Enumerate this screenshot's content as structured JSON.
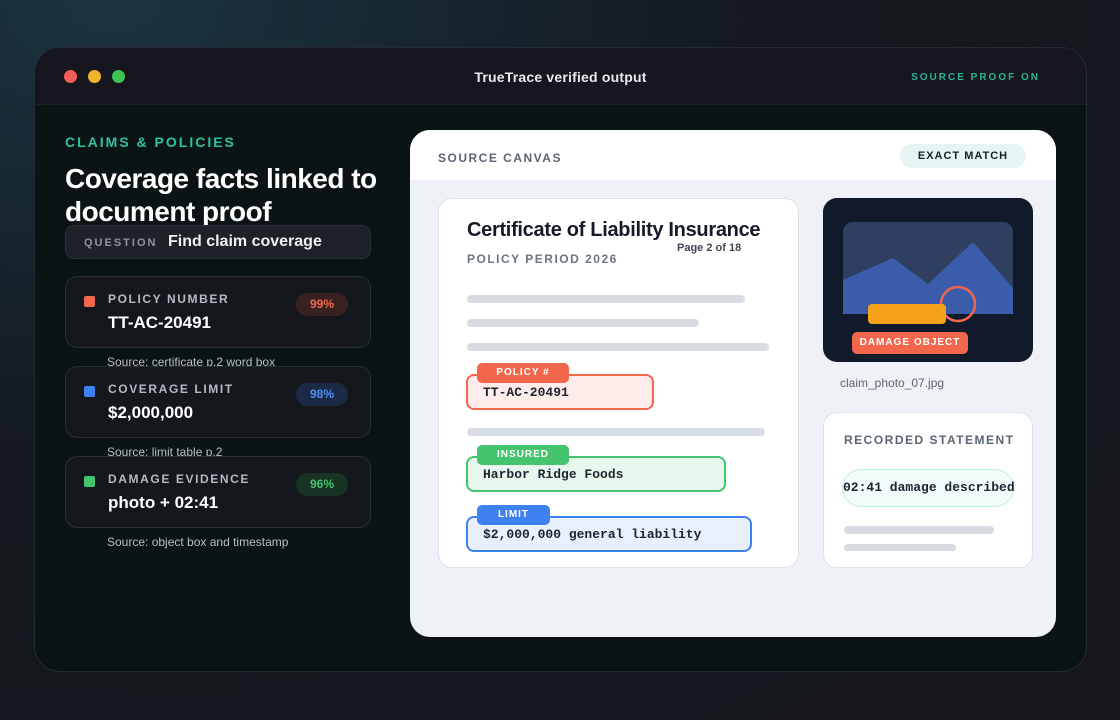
{
  "window": {
    "title": "TrueTrace verified output",
    "proof_status": "SOURCE PROOF ON"
  },
  "sidebar": {
    "eyebrow": "CLAIMS & POLICIES",
    "headline": "Coverage facts linked to document proof",
    "question_label": "QUESTION",
    "question_text": "Find claim coverage",
    "facts": [
      {
        "label": "POLICY NUMBER",
        "value": "TT-AC-20491",
        "confidence": "99%",
        "source": "Source: certificate p.2 word box",
        "color": "#f2674c"
      },
      {
        "label": "COVERAGE LIMIT",
        "value": "$2,000,000",
        "confidence": "98%",
        "source": "Source: limit table p.2",
        "color": "#3d82f0"
      },
      {
        "label": "DAMAGE EVIDENCE",
        "value": "photo + 02:41",
        "confidence": "96%",
        "source": "Source: object box and timestamp",
        "color": "#45c46e"
      }
    ]
  },
  "canvas": {
    "title": "SOURCE CANVAS",
    "match_badge": "EXACT MATCH",
    "document": {
      "title": "Certificate of Liability Insurance",
      "page": "Page 2 of 18",
      "period": "POLICY PERIOD 2026",
      "fields": [
        {
          "tag": "POLICY #",
          "value": "TT-AC-20491",
          "color": "#f2674c"
        },
        {
          "tag": "INSURED",
          "value": "Harbor Ridge Foods",
          "color": "#45c46e"
        },
        {
          "tag": "LIMIT",
          "value": "$2,000,000 general liability",
          "color": "#3d82f0"
        }
      ]
    },
    "photo": {
      "tag": "DAMAGE OBJECT",
      "caption": "claim_photo_07.jpg"
    },
    "statement": {
      "title": "RECORDED STATEMENT",
      "quote": "02:41 damage described"
    }
  },
  "colors": {
    "accent_teal": "#2ec2a2",
    "policy_orange": "#f2674c",
    "limit_blue": "#3d82f0",
    "evidence_green": "#45c46e"
  }
}
